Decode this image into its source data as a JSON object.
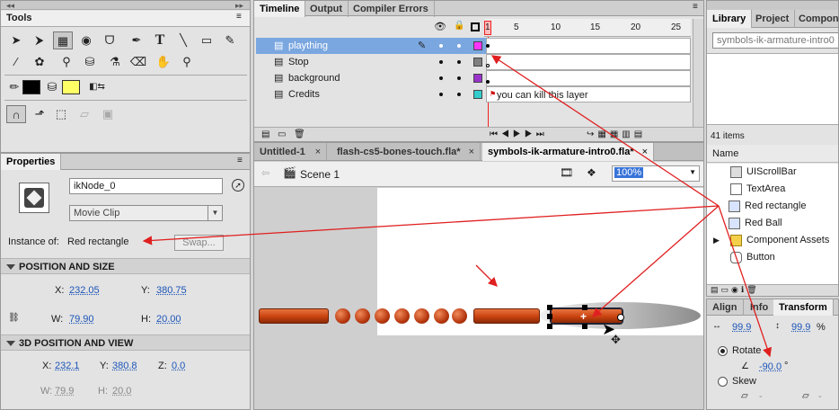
{
  "tools": {
    "title": "Tools",
    "icons": [
      "selection-arrow",
      "subselection-arrow",
      "free-transform",
      "3d-rotation",
      "lasso",
      "pen",
      "text",
      "line",
      "rectangle",
      "pencil",
      "brush",
      "deco",
      "bone",
      "paint-bucket",
      "eyedropper",
      "eraser",
      "hand",
      "zoom",
      "stroke-color",
      "fill-color",
      "swap-colors",
      "snap",
      "smooth",
      "straighten",
      "object-drawing",
      "lock-fill"
    ],
    "stroke_color": "#000000",
    "fill_color": "#ffff66"
  },
  "timeline": {
    "tabs": [
      "Timeline",
      "Output",
      "Compiler Errors"
    ],
    "frame_numbers": [
      "1",
      "5",
      "10",
      "15",
      "20",
      "25"
    ],
    "layers": [
      {
        "name": "plaything",
        "color": "#ff33ff",
        "selected": true
      },
      {
        "name": "Stop",
        "color": "#808080"
      },
      {
        "name": "background",
        "color": "#9933cc"
      },
      {
        "name": "Credits",
        "color": "#33cccc",
        "frame_label": "you can kill this layer"
      }
    ]
  },
  "document": {
    "tabs": [
      "Untitled-1",
      "flash-cs5-bones-touch.fla*",
      "symbols-ik-armature-intro0.fla*"
    ],
    "scene": "Scene 1",
    "zoom": "100%"
  },
  "properties": {
    "tab": "Properties",
    "instance_name": "ikNode_0",
    "symbol_type": "Movie Clip",
    "instance_of_label": "Instance of:",
    "instance_of_value": "Red rectangle",
    "swap_label": "Swap...",
    "position_section": "POSITION AND SIZE",
    "x_label": "X:",
    "x_value": "232.05",
    "y_label": "Y:",
    "y_value": "380.75",
    "w_label": "W:",
    "w_value": "79.90",
    "h_label": "H:",
    "h_value": "20.00",
    "view3d_section": "3D POSITION AND VIEW",
    "x3d_value": "232.1",
    "y3d_value": "380.8",
    "z_label": "Z:",
    "z_value": "0.0",
    "w3d_value": "79.9",
    "h3d_value": "20.0"
  },
  "library": {
    "tabs": [
      "Library",
      "Project",
      "Componen"
    ],
    "doc_select": "symbols-ik-armature-intro0",
    "count": "41 items",
    "name_header": "Name",
    "items": [
      "UIScrollBar",
      "TextArea",
      "Red rectangle",
      "Red Ball",
      "Component Assets",
      "Button"
    ]
  },
  "transform": {
    "tabs": [
      "Align",
      "Info",
      "Transform"
    ],
    "scale_w": "99.9",
    "scale_h": "99.9",
    "percent": "%",
    "rotate_label": "Rotate",
    "rotate_value": "-90.0",
    "degree": "°",
    "skew_label": "Skew",
    "skew_h": "-",
    "skew_v": "-"
  }
}
